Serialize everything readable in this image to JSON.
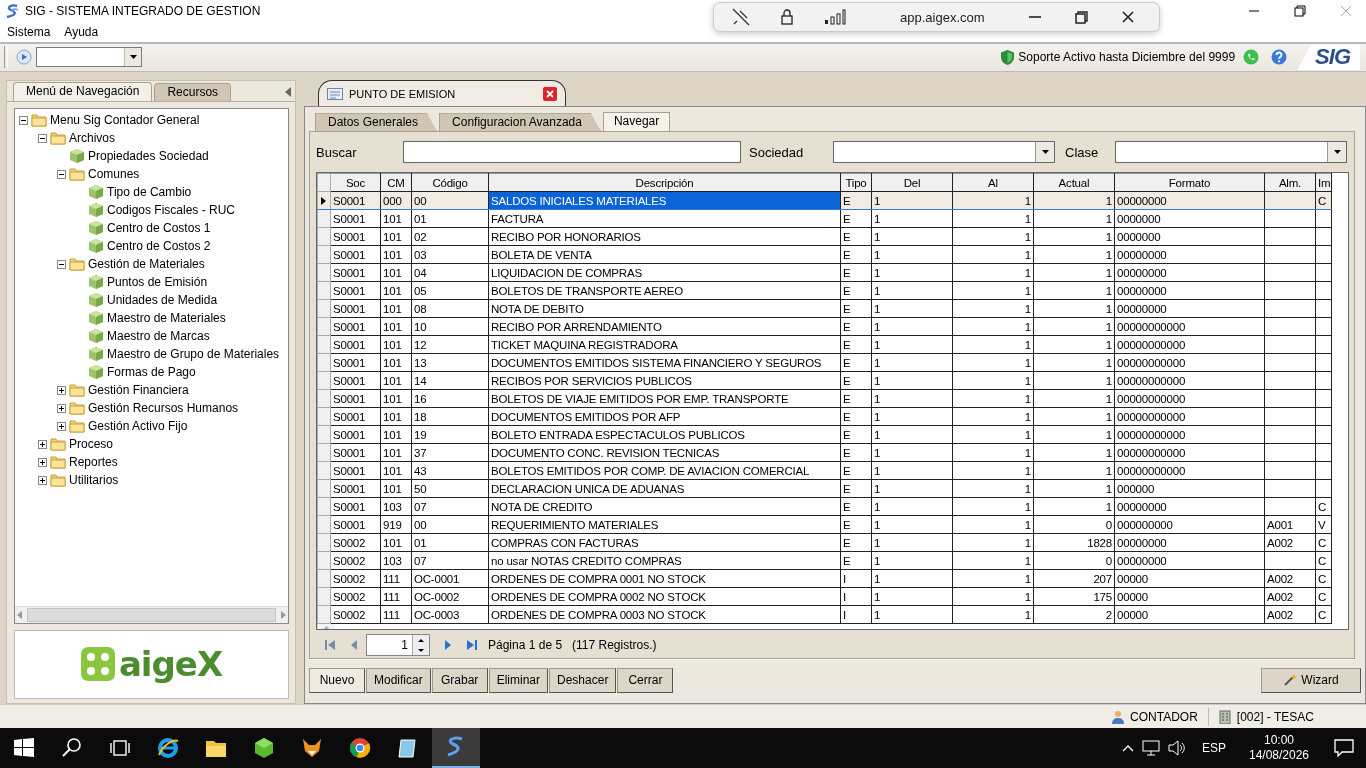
{
  "window": {
    "title": "SIG - SISTEMA INTEGRADO DE GESTION"
  },
  "menu": [
    "Sistema",
    "Ayuda"
  ],
  "remote_bar": {
    "address": "app.aigex.com"
  },
  "toolbar": {
    "support": "Soporte Activo hasta Diciembre del 9999",
    "logo": "SIG"
  },
  "nav": {
    "tabs": [
      {
        "label": "Menú de Navegación",
        "selected": true
      },
      {
        "label": "Recursos",
        "selected": false
      }
    ],
    "tree": [
      {
        "label": "Menu Sig  Contador General",
        "kind": "folder",
        "expanded": true,
        "children": [
          {
            "label": "Archivos",
            "kind": "folder",
            "expanded": true,
            "children": [
              {
                "label": "Propiedades Sociedad",
                "kind": "item"
              },
              {
                "label": "Comunes",
                "kind": "folder",
                "expanded": true,
                "children": [
                  {
                    "label": "Tipo de Cambio",
                    "kind": "item"
                  },
                  {
                    "label": "Codigos Fiscales - RUC",
                    "kind": "item"
                  },
                  {
                    "label": "Centro de Costos 1",
                    "kind": "item"
                  },
                  {
                    "label": "Centro de Costos 2",
                    "kind": "item"
                  }
                ]
              },
              {
                "label": "Gestión de Materiales",
                "kind": "folder",
                "expanded": true,
                "children": [
                  {
                    "label": "Puntos de Emisión",
                    "kind": "item"
                  },
                  {
                    "label": "Unidades de Medida",
                    "kind": "item"
                  },
                  {
                    "label": "Maestro de Materiales",
                    "kind": "item"
                  },
                  {
                    "label": "Maestro de Marcas",
                    "kind": "item"
                  },
                  {
                    "label": "Maestro de Grupo de Materiales",
                    "kind": "item"
                  },
                  {
                    "label": "Formas de Pago",
                    "kind": "item"
                  }
                ]
              },
              {
                "label": "Gestión Financiera",
                "kind": "folder",
                "expanded": false
              },
              {
                "label": "Gestión Recursos Humanos",
                "kind": "folder",
                "expanded": false
              },
              {
                "label": "Gestión Activo Fijo",
                "kind": "folder",
                "expanded": false
              }
            ]
          },
          {
            "label": "Proceso",
            "kind": "folder",
            "expanded": false
          },
          {
            "label": "Reportes",
            "kind": "folder",
            "expanded": false
          },
          {
            "label": "Utilitarios",
            "kind": "folder",
            "expanded": false
          }
        ]
      }
    ],
    "logo": "aigeX"
  },
  "document_tab": {
    "title": "PUNTO DE EMISION"
  },
  "tabs": [
    {
      "label": "Datos Generales",
      "selected": false
    },
    {
      "label": "Configuracion Avanzada",
      "selected": false
    },
    {
      "label": "Navegar",
      "selected": true
    }
  ],
  "filters": [
    {
      "label": "Buscar",
      "kind": "text"
    },
    {
      "label": "Sociedad",
      "kind": "combo"
    },
    {
      "label": "Clase",
      "kind": "combo"
    }
  ],
  "table": {
    "columns": [
      "Soc",
      "CM",
      "Código",
      "Descripción",
      "Tipo",
      "Del",
      "Al",
      "Actual",
      "Formato",
      "Alm.",
      "Im"
    ],
    "rows": [
      {
        "selected": true,
        "cells": [
          "S0001",
          "000",
          "00",
          "SALDOS INICIALES MATERIALES",
          "E",
          "1",
          "1",
          "1",
          "00000000",
          "",
          "C"
        ]
      },
      {
        "selected": false,
        "cells": [
          "S0001",
          "101",
          "01",
          "FACTURA",
          "E",
          "1",
          "1",
          "1",
          "0000000",
          "",
          ""
        ]
      },
      {
        "selected": false,
        "cells": [
          "S0001",
          "101",
          "02",
          "RECIBO POR HONORARIOS",
          "E",
          "1",
          "1",
          "1",
          "0000000",
          "",
          ""
        ]
      },
      {
        "selected": false,
        "cells": [
          "S0001",
          "101",
          "03",
          "BOLETA DE VENTA",
          "E",
          "1",
          "1",
          "1",
          "00000000",
          "",
          ""
        ]
      },
      {
        "selected": false,
        "cells": [
          "S0001",
          "101",
          "04",
          "LIQUIDACION DE COMPRAS",
          "E",
          "1",
          "1",
          "1",
          "00000000",
          "",
          ""
        ]
      },
      {
        "selected": false,
        "cells": [
          "S0001",
          "101",
          "05",
          "BOLETOS DE TRANSPORTE AEREO",
          "E",
          "1",
          "1",
          "1",
          "00000000",
          "",
          ""
        ]
      },
      {
        "selected": false,
        "cells": [
          "S0001",
          "101",
          "08",
          "NOTA DE DEBITO",
          "E",
          "1",
          "1",
          "1",
          "00000000",
          "",
          ""
        ]
      },
      {
        "selected": false,
        "cells": [
          "S0001",
          "101",
          "10",
          "RECIBO POR ARRENDAMIENTO",
          "E",
          "1",
          "1",
          "1",
          "00000000000",
          "",
          ""
        ]
      },
      {
        "selected": false,
        "cells": [
          "S0001",
          "101",
          "12",
          "TICKET MAQUINA REGISTRADORA",
          "E",
          "1",
          "1",
          "1",
          "00000000000",
          "",
          ""
        ]
      },
      {
        "selected": false,
        "cells": [
          "S0001",
          "101",
          "13",
          "DOCUMENTOS EMITIDOS SISTEMA FINANCIERO Y SEGUROS",
          "E",
          "1",
          "1",
          "1",
          "00000000000",
          "",
          ""
        ]
      },
      {
        "selected": false,
        "cells": [
          "S0001",
          "101",
          "14",
          "RECIBOS POR SERVICIOS PUBLICOS",
          "E",
          "1",
          "1",
          "1",
          "00000000000",
          "",
          ""
        ]
      },
      {
        "selected": false,
        "cells": [
          "S0001",
          "101",
          "16",
          "BOLETOS DE VIAJE EMITIDOS POR EMP. TRANSPORTE",
          "E",
          "1",
          "1",
          "1",
          "00000000000",
          "",
          ""
        ]
      },
      {
        "selected": false,
        "cells": [
          "S0001",
          "101",
          "18",
          "DOCUMENTOS EMITIDOS POR AFP",
          "E",
          "1",
          "1",
          "1",
          "00000000000",
          "",
          ""
        ]
      },
      {
        "selected": false,
        "cells": [
          "S0001",
          "101",
          "19",
          "BOLETO ENTRADA ESPECTACULOS PUBLICOS",
          "E",
          "1",
          "1",
          "1",
          "00000000000",
          "",
          ""
        ]
      },
      {
        "selected": false,
        "cells": [
          "S0001",
          "101",
          "37",
          "DOCUMENTO CONC. REVISION TECNICAS",
          "E",
          "1",
          "1",
          "1",
          "00000000000",
          "",
          ""
        ]
      },
      {
        "selected": false,
        "cells": [
          "S0001",
          "101",
          "43",
          "BOLETOS EMITIDOS POR COMP. DE AVIACION COMERCIAL",
          "E",
          "1",
          "1",
          "1",
          "00000000000",
          "",
          ""
        ]
      },
      {
        "selected": false,
        "cells": [
          "S0001",
          "101",
          "50",
          "DECLARACION UNICA DE ADUANAS",
          "E",
          "1",
          "1",
          "1",
          "000000",
          "",
          ""
        ]
      },
      {
        "selected": false,
        "cells": [
          "S0001",
          "103",
          "07",
          "NOTA DE CREDITO",
          "E",
          "1",
          "1",
          "1",
          "00000000",
          "",
          "C"
        ]
      },
      {
        "selected": false,
        "cells": [
          "S0001",
          "919",
          "00",
          "REQUERIMIENTO MATERIALES",
          "E",
          "1",
          "1",
          "0",
          "000000000",
          "A001",
          "V"
        ]
      },
      {
        "selected": false,
        "cells": [
          "S0002",
          "101",
          "01",
          "COMPRAS CON FACTURAS",
          "E",
          "1",
          "1",
          "1828",
          "00000000",
          "A002",
          "C"
        ]
      },
      {
        "selected": false,
        "cells": [
          "S0002",
          "103",
          "07",
          "no usar  NOTAS CREDITO COMPRAS",
          "E",
          "1",
          "1",
          "0",
          "00000000",
          "",
          "C"
        ]
      },
      {
        "selected": false,
        "cells": [
          "S0002",
          "111",
          "OC-0001",
          "ORDENES DE COMPRA  0001 NO STOCK",
          "I",
          "1",
          "1",
          "207",
          "00000",
          "A002",
          "C"
        ]
      },
      {
        "selected": false,
        "cells": [
          "S0002",
          "111",
          "OC-0002",
          "ORDENES DE COMPRA  0002 NO STOCK",
          "I",
          "1",
          "1",
          "175",
          "00000",
          "A002",
          "C"
        ]
      },
      {
        "selected": false,
        "cells": [
          "S0002",
          "111",
          "OC-0003",
          "ORDENES DE COMPRA  0003 NO STOCK",
          "I",
          "1",
          "1",
          "2",
          "00000",
          "A002",
          "C"
        ]
      }
    ]
  },
  "pager": {
    "page": "1",
    "info": "Página 1 de 5",
    "count": "(117 Registros.)"
  },
  "buttons": [
    "Nuevo",
    "Modificar",
    "Grabar",
    "Eliminar",
    "Deshacer",
    "Cerrar"
  ],
  "wizard": "Wizard",
  "status": {
    "user": "CONTADOR",
    "company": "[002] - TESAC"
  },
  "taskbar": {
    "language": "ESP",
    "time": "10:00",
    "date": "14/08/2026"
  }
}
